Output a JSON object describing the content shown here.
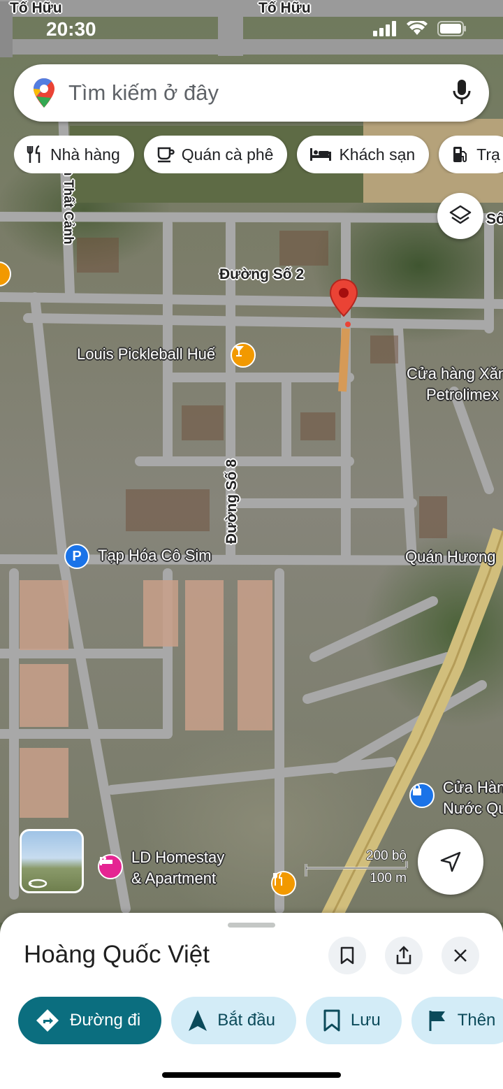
{
  "status_bar": {
    "time": "20:30"
  },
  "search": {
    "placeholder": "Tìm kiếm ở đây"
  },
  "chips": [
    {
      "label": "Nhà hàng",
      "icon": "fork-knife-icon"
    },
    {
      "label": "Quán cà phê",
      "icon": "coffee-cup-icon"
    },
    {
      "label": "Khách sạn",
      "icon": "bed-icon"
    },
    {
      "label": "Trạ",
      "icon": "gas-station-icon"
    }
  ],
  "map": {
    "roads": {
      "to_huu_left": "Tố Hữu",
      "to_huu_right": "Tố Hữu",
      "that_canh": "n Thất Cảnh",
      "duong_so_2": "Đường Số 2",
      "duong_so_8": "Đường Số 8",
      "so_right": "Số"
    },
    "places": {
      "pickleball": "Louis Pickleball Huế",
      "cua_hang_xang_1": "Cửa hàng Xăn",
      "cua_hang_xang_2": "Petrolimex",
      "tap_hoa": "Tạp Hóa Cô Sim",
      "quan_huong": "Quán Hương",
      "homestay_1": "LD Homestay",
      "homestay_2": "& Apartment",
      "cua_hang_nuoc_1": "Cửa Hàn",
      "cua_hang_nuoc_2": "Nước Qu"
    },
    "scale": {
      "feet": "200 bộ",
      "meters": "100 m"
    }
  },
  "place_sheet": {
    "title": "Hoàng Quốc Việt",
    "actions": [
      {
        "label": "Đường đi",
        "icon": "directions-icon"
      },
      {
        "label": "Bắt đầu",
        "icon": "navigation-arrow-icon"
      },
      {
        "label": "Lưu",
        "icon": "bookmark-icon"
      },
      {
        "label": "Thên",
        "icon": "flag-icon"
      }
    ]
  },
  "colors": {
    "accent_teal": "#0b6e7f",
    "action_bg": "#d3ecf7",
    "pin_red": "#ea4335",
    "poi_orange": "#f29900",
    "poi_blue": "#1a73e8",
    "poi_pink": "#e52592"
  }
}
